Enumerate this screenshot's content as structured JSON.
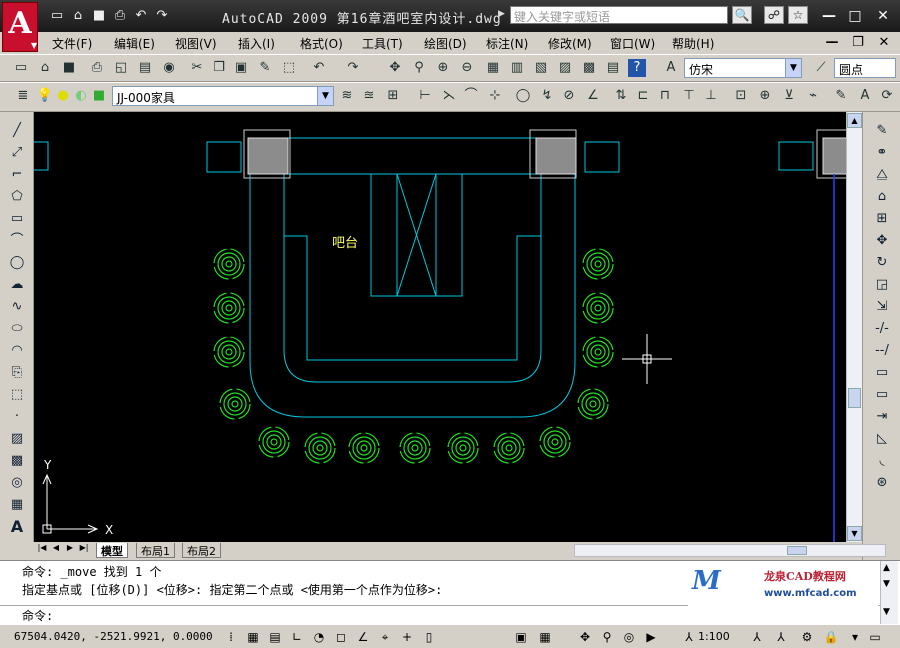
{
  "window": {
    "app_logo": "A",
    "title": "AutoCAD 2009  第16章酒吧室内设计.dwg",
    "search_placeholder": "键入关键字或短语",
    "controls": [
      "—",
      "□",
      "✕"
    ],
    "doc_controls": [
      "—",
      "❐",
      "✕"
    ]
  },
  "menu": [
    "文件(F)",
    "编辑(E)",
    "视图(V)",
    "插入(I)",
    "格式(O)",
    "工具(T)",
    "绘图(D)",
    "标注(N)",
    "修改(M)",
    "窗口(W)",
    "帮助(H)"
  ],
  "toolbar1": {
    "text_style": "仿宋",
    "dim_style": "圆点"
  },
  "toolbar2": {
    "layer": "JJ-000家具"
  },
  "drawing": {
    "bar_label": "吧台",
    "ucs_x": "X",
    "ucs_y": "Y",
    "colors": {
      "background": "#000000",
      "lines": "#00c8e0",
      "chairs": "#22dd22",
      "label": "#ffff66"
    }
  },
  "tabs": {
    "model": "模型",
    "layout1": "布局1",
    "layout2": "布局2"
  },
  "command": {
    "line1": "命令:  _move 找到 1 个",
    "line2": "指定基点或 [位移(D)] <位移>:  指定第二个点或 <使用第一个点作为位移>:",
    "prompt": "命令:"
  },
  "watermark": {
    "text": "龙泉CAD教程网",
    "url": "www.mfcad.com"
  },
  "status": {
    "coordinates": "67504.0420, -2521.9921, 0.0000",
    "annotation_scale": "1:100"
  }
}
